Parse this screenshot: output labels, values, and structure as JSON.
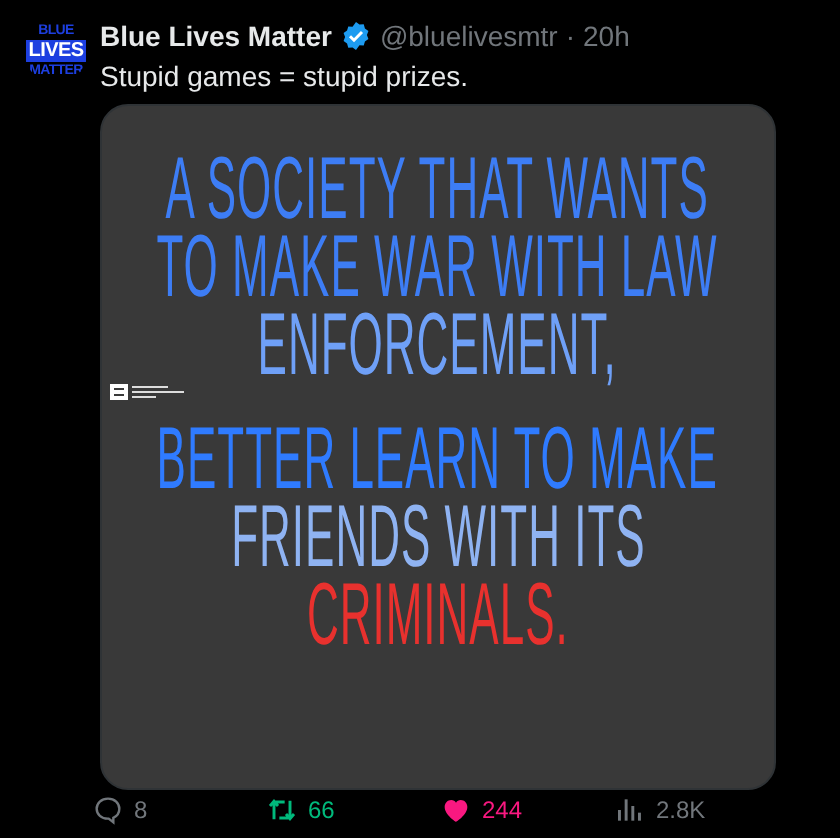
{
  "tweet": {
    "avatar_text": [
      "BLUE",
      "LIVES",
      "MATTER"
    ],
    "name": "Blue Lives Matter",
    "verified": true,
    "handle": "@bluelivesmtr",
    "separator": "·",
    "time": "20h",
    "text": "Stupid games = stupid prizes.",
    "image": {
      "lines": [
        {
          "text": "A SOCIETY THAT WANTS",
          "color": "#3d7df5"
        },
        {
          "text": "TO MAKE WAR WITH LAW",
          "color": "#3d7df5"
        },
        {
          "text": "ENFORCEMENT,",
          "color": "#6fa0f7"
        },
        {
          "text": "BETTER LEARN TO MAKE",
          "color": "#2f7bff"
        },
        {
          "text": "FRIENDS WITH ITS",
          "color": "#8fb3f2"
        },
        {
          "text": "CRIMINALS.",
          "color": "#e8312e"
        }
      ]
    },
    "actions": [
      {
        "kind": "reply",
        "count": "8"
      },
      {
        "kind": "repost",
        "count": "66",
        "active": true
      },
      {
        "kind": "like",
        "count": "244",
        "active": true
      },
      {
        "kind": "views",
        "count": "2.8K"
      }
    ]
  }
}
